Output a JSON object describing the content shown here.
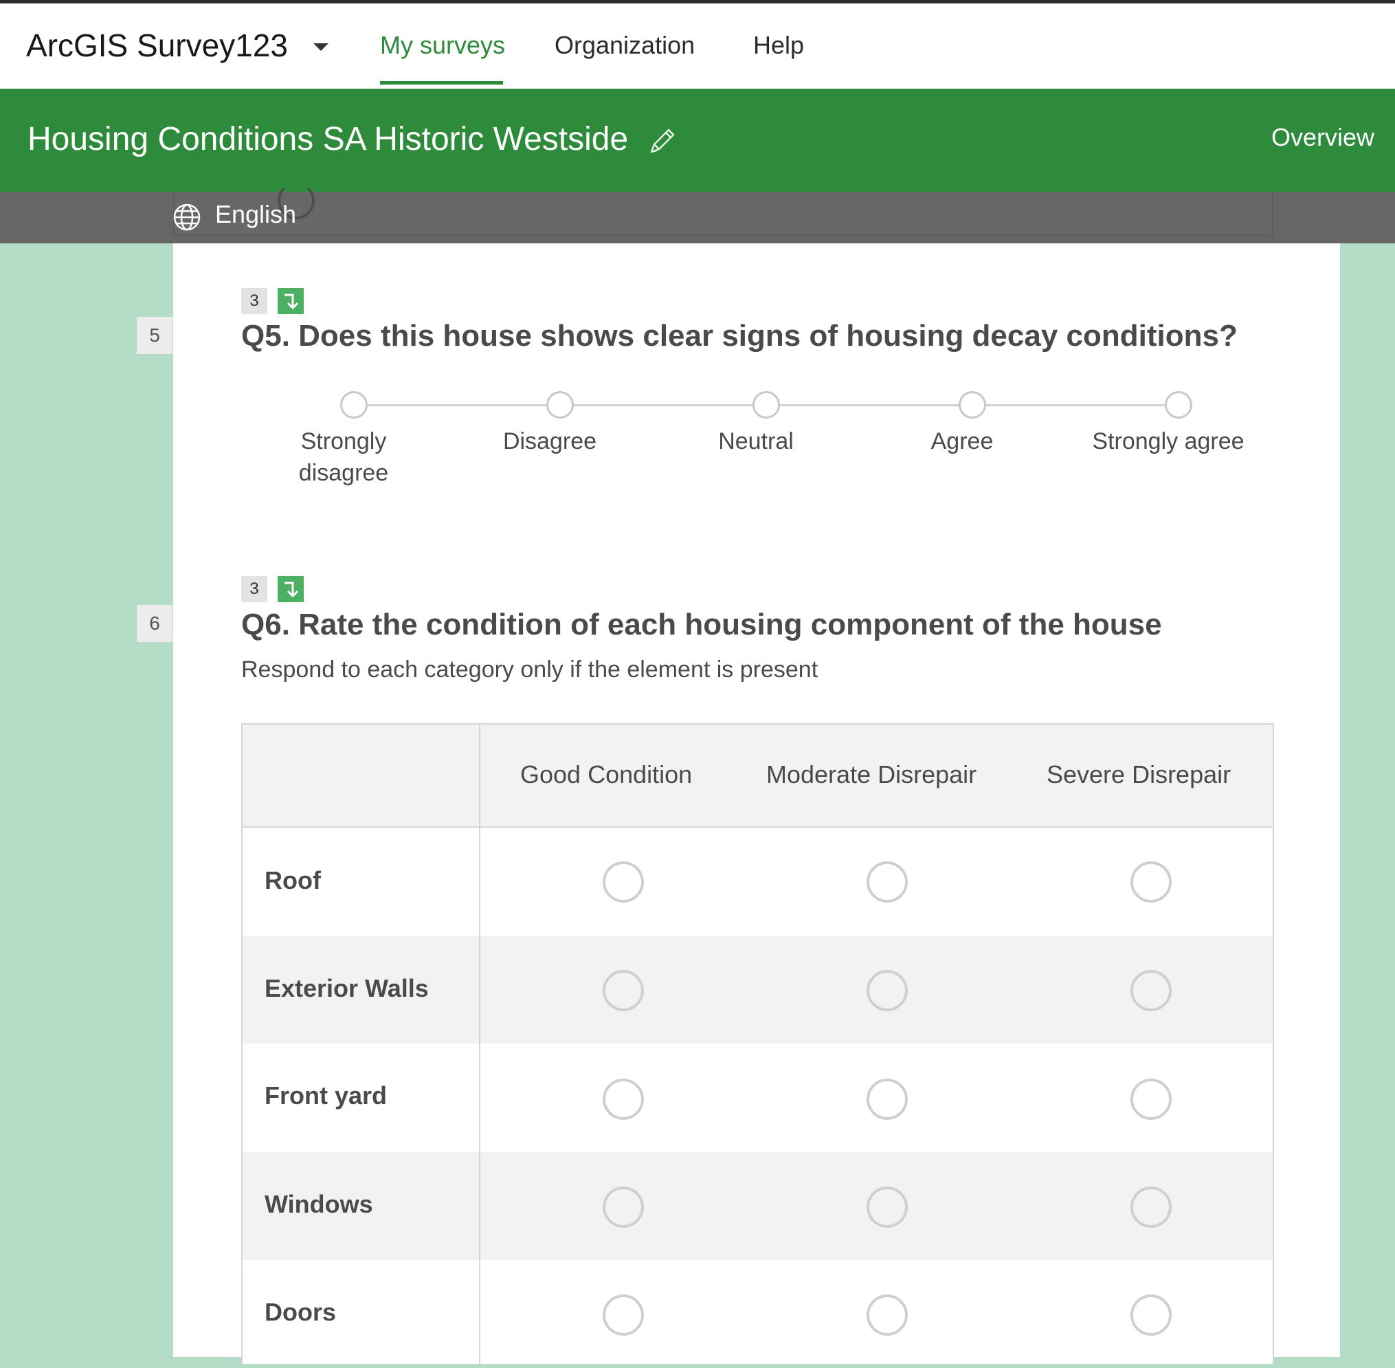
{
  "app": {
    "brand": "ArcGIS Survey123",
    "nav": [
      {
        "label": "My surveys",
        "active": true
      },
      {
        "label": "Organization",
        "active": false
      },
      {
        "label": "Help",
        "active": false
      }
    ]
  },
  "survey": {
    "title": "Housing Conditions SA Historic Westside",
    "overview_label": "Overview",
    "language": "English"
  },
  "colors": {
    "accent": "#2e8b3b",
    "page_bg": "#b5dcc6",
    "lang_bar": "#666666"
  },
  "icons": [
    "chevron-down-icon",
    "pencil-icon",
    "globe-icon",
    "arrow-down-right-icon"
  ],
  "questions": [
    {
      "side_number": "5",
      "badge": "3",
      "title": "Q5. Does this house shows clear signs of housing decay conditions?",
      "options": [
        "Strongly disagree",
        "Disagree",
        "Neutral",
        "Agree",
        "Strongly agree"
      ],
      "option_lines": [
        [
          "Strongly",
          "disagree"
        ],
        [
          "Disagree"
        ],
        [
          "Neutral"
        ],
        [
          "Agree"
        ],
        [
          "Strongly agree"
        ]
      ]
    },
    {
      "side_number": "6",
      "badge": "3",
      "title": "Q6. Rate the condition of each housing component of the house",
      "hint": "Respond to each category only if the element is present",
      "columns": [
        "Good Condition",
        "Moderate Disrepair",
        "Severe Disrepair"
      ],
      "rows": [
        "Roof",
        "Exterior Walls",
        "Front yard",
        "Windows",
        "Doors"
      ]
    }
  ]
}
